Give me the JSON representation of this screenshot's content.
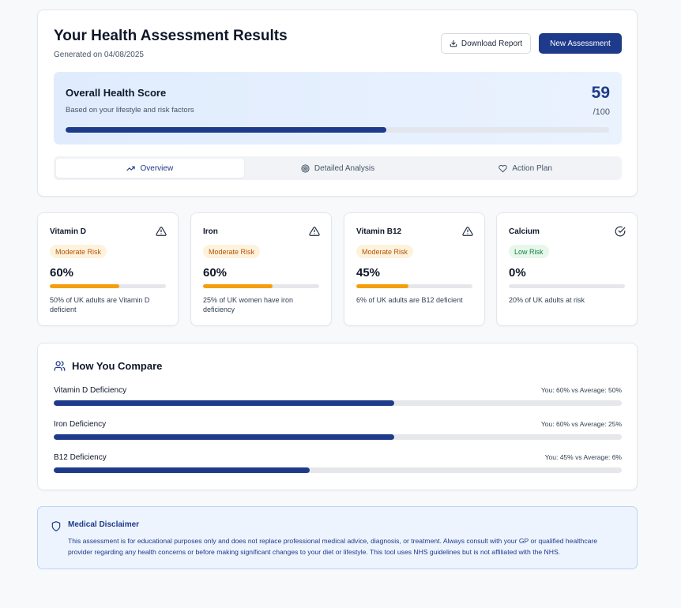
{
  "header": {
    "title": "Your Health Assessment Results",
    "generated": "Generated on 04/08/2025",
    "download_label": "Download Report",
    "new_assessment_label": "New Assessment"
  },
  "score": {
    "title": "Overall Health Score",
    "subtitle": "Based on your lifestyle and risk factors",
    "value": "59",
    "max": "/100",
    "fill_percent": 59
  },
  "tabs": [
    {
      "label": "Overview",
      "icon": "trending-up-icon",
      "active": true
    },
    {
      "label": "Detailed Analysis",
      "icon": "target-icon",
      "active": false
    },
    {
      "label": "Action Plan",
      "icon": "heart-icon",
      "active": false
    }
  ],
  "nutrients": [
    {
      "name": "Vitamin D",
      "badge": "Moderate Risk",
      "level": "moderate",
      "pct": "60%",
      "fill_percent": 60,
      "note": "50% of UK adults are Vitamin D deficient",
      "icon": "warning-triangle-icon"
    },
    {
      "name": "Iron",
      "badge": "Moderate Risk",
      "level": "moderate",
      "pct": "60%",
      "fill_percent": 60,
      "note": "25% of UK women have iron deficiency",
      "icon": "warning-triangle-icon"
    },
    {
      "name": "Vitamin B12",
      "badge": "Moderate Risk",
      "level": "moderate",
      "pct": "45%",
      "fill_percent": 45,
      "note": "6% of UK adults are B12 deficient",
      "icon": "warning-triangle-icon"
    },
    {
      "name": "Calcium",
      "badge": "Low Risk",
      "level": "low",
      "pct": "0%",
      "fill_percent": 0,
      "note": "20% of UK adults at risk",
      "icon": "check-circle-icon"
    }
  ],
  "compare": {
    "title": "How You Compare",
    "icon": "users-icon",
    "rows": [
      {
        "label": "Vitamin D Deficiency",
        "stat": "You: 60% vs Average: 50%",
        "fill_percent": 60
      },
      {
        "label": "Iron Deficiency",
        "stat": "You: 60% vs Average: 25%",
        "fill_percent": 60
      },
      {
        "label": "B12 Deficiency",
        "stat": "You: 45% vs Average: 6%",
        "fill_percent": 45
      }
    ]
  },
  "disclaimer": {
    "title": "Medical Disclaimer",
    "icon": "shield-icon",
    "text": "This assessment is for educational purposes only and does not replace professional medical advice, diagnosis, or treatment. Always consult with your GP or qualified healthcare provider regarding any health concerns or before making significant changes to your diet or lifestyle. This tool uses NHS guidelines but is not affiliated with the NHS."
  },
  "colors": {
    "primary": "#1e3a8a",
    "warning": "#f59e0b",
    "moderate_text": "#b45309",
    "low_text": "#15803d",
    "background": "#f8f9fb"
  }
}
